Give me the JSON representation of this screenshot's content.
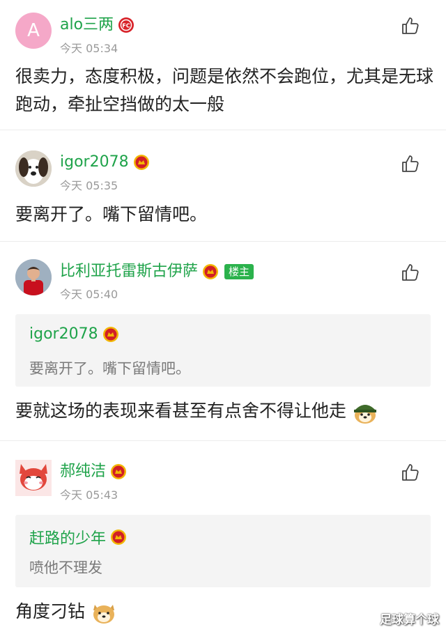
{
  "comments": [
    {
      "username": "alo三两",
      "avatar_letter": "A",
      "badge": "fc-club-badge-icon",
      "time": "今天 05:34",
      "text": "很卖力，态度积极，问题是依然不会跑位，尤其是无球跑动，牵扯空挡做的太一般"
    },
    {
      "username": "igor2078",
      "badge": "man-utd-badge-icon",
      "time": "今天 05:35",
      "text": "要离开了。嘴下留情吧。"
    },
    {
      "username": "比利亚托雷斯古伊萨",
      "badge": "man-utd-badge-icon",
      "tag": "楼主",
      "time": "今天 05:40",
      "quote": {
        "username": "igor2078",
        "text": "要离开了。嘴下留情吧。"
      },
      "text": "要就这场的表现来看甚至有点舍不得让他走"
    },
    {
      "username": "郝纯洁",
      "badge": "man-utd-badge-icon",
      "time": "今天 05:43",
      "quote": {
        "username": "赶路的少年",
        "text": "喷他不理发"
      },
      "text": "角度刁钻"
    }
  ],
  "watermark": "足球算个球",
  "colors": {
    "username": "#1fa34a",
    "tag_bg": "#2bb24c",
    "time": "#9a9a9a",
    "quote_bg": "#f4f4f4"
  }
}
